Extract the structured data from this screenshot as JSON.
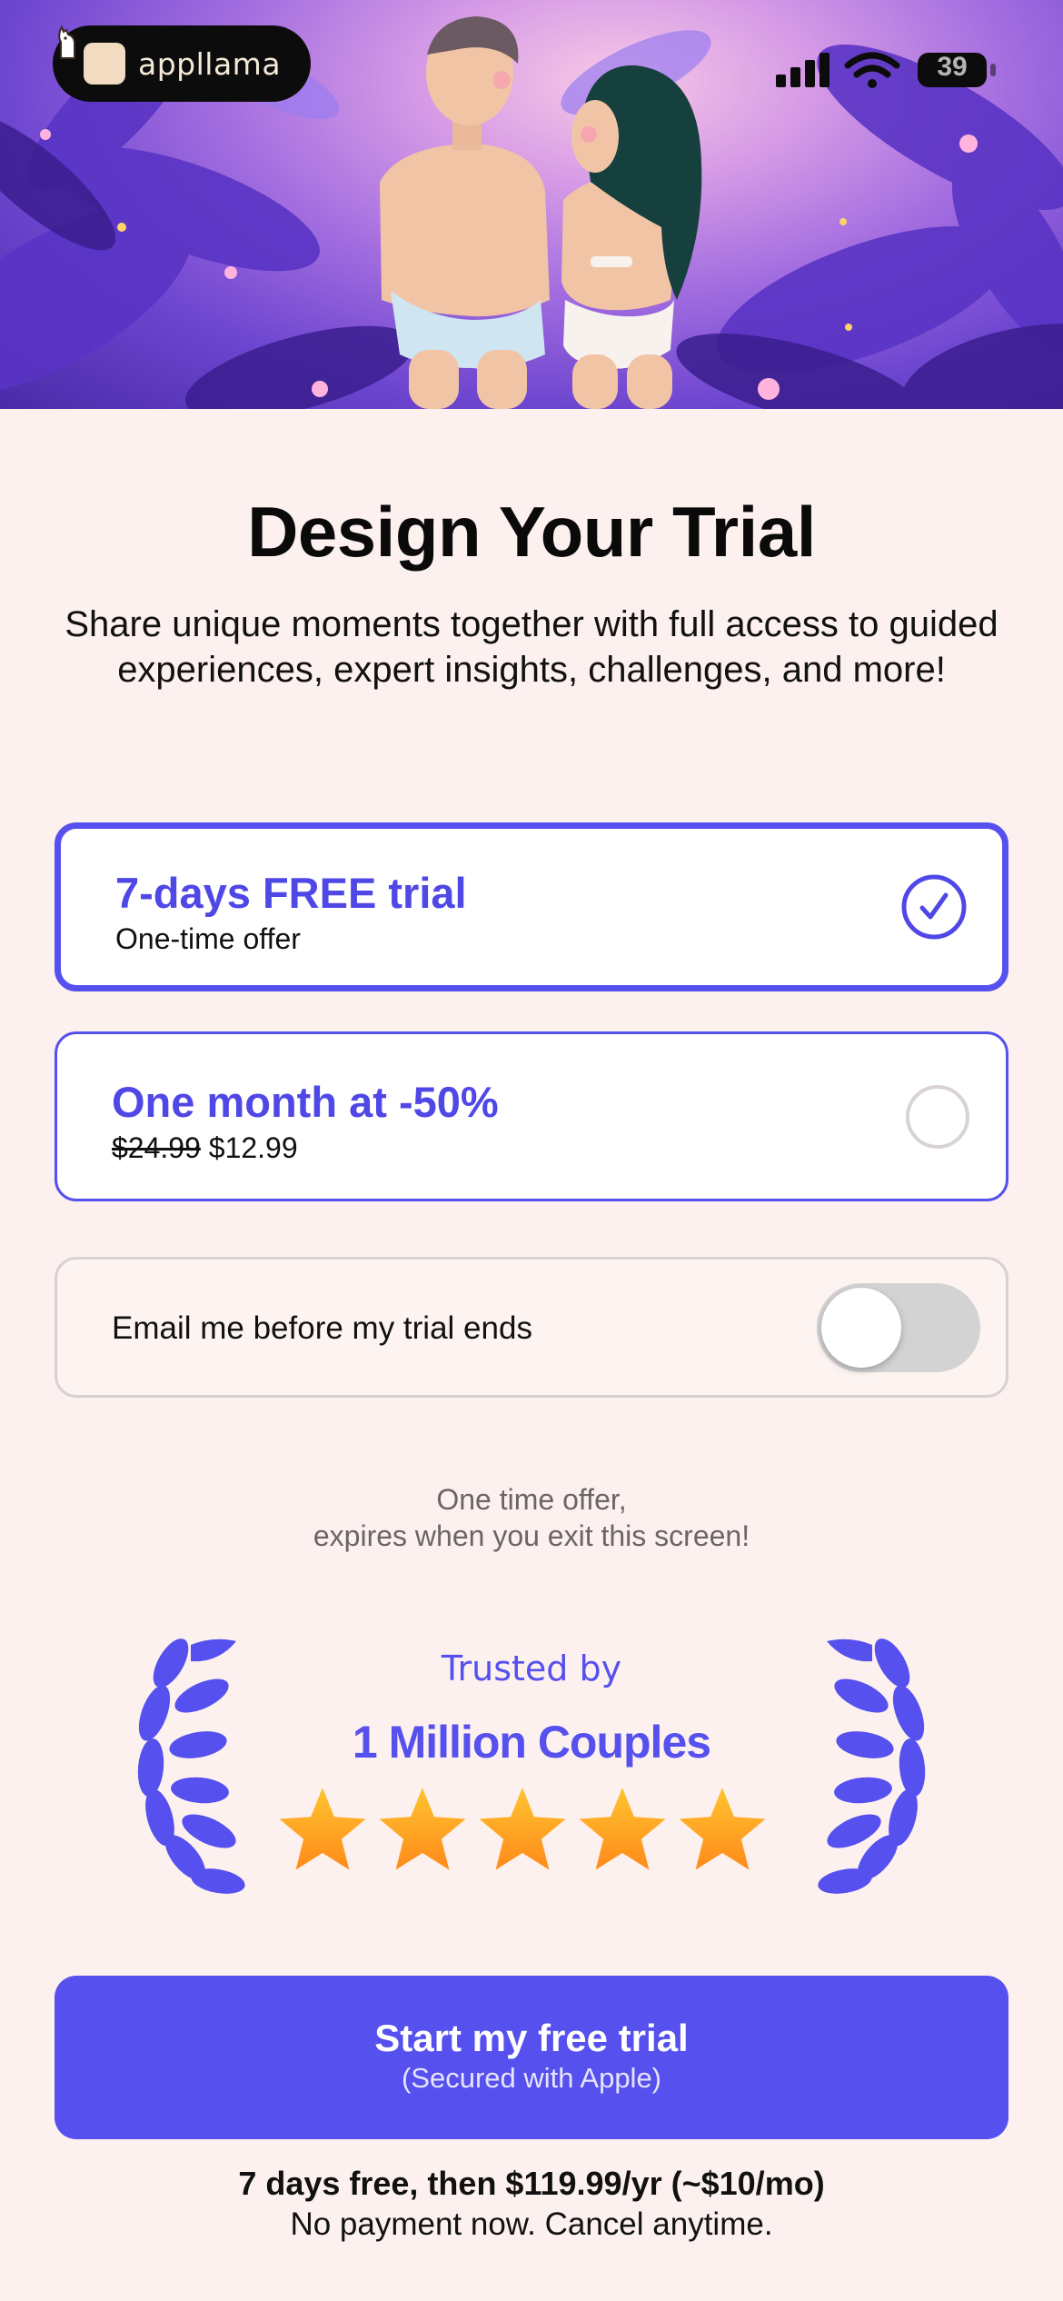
{
  "brand": {
    "name": "appllama",
    "logo_icon": "llama-icon"
  },
  "status_bar": {
    "battery": "39",
    "signal_icon": "cellular-signal-icon",
    "wifi_icon": "wifi-icon"
  },
  "title": "Design Your Trial",
  "subtitle": "Share unique moments together with full access to guided experiences, expert insights, challenges, and more!",
  "plans": [
    {
      "title": "7-days FREE trial",
      "subtitle": "One-time offer",
      "selected": true
    },
    {
      "title": "One month at -50%",
      "old_price": "$24.99",
      "new_price": "$12.99",
      "selected": false
    }
  ],
  "email_toggle": {
    "label": "Email me before my trial ends",
    "on": false
  },
  "offer_note": {
    "line1": "One time offer,",
    "line2": "expires when you exit this screen!"
  },
  "trust": {
    "trusted_by": "Trusted by",
    "count": "1 Million Couples",
    "rating_stars": 5
  },
  "cta": {
    "label": "Start my free trial",
    "sublabel": "(Secured with Apple)"
  },
  "footer": {
    "line1": "7 days free, then $119.99/yr (~$10/mo)",
    "line2": "No payment now. Cancel anytime."
  },
  "colors": {
    "accent": "#5550ee",
    "background": "#fdf1ef",
    "star": "#ffb020"
  }
}
